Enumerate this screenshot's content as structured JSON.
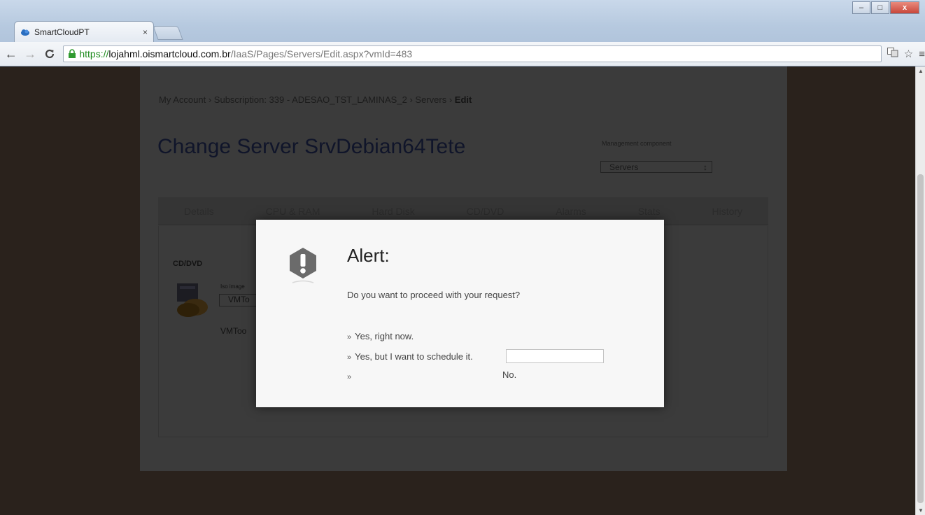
{
  "browser": {
    "tab_title": "SmartCloudPT",
    "tab_close": "×",
    "url": {
      "scheme": "https://",
      "host": "lojahml.oismartcloud.com.br",
      "path": "/IaaS/Pages/Servers/Edit.aspx?vmId=483"
    },
    "window_controls": [
      "–",
      "□",
      "x"
    ]
  },
  "page": {
    "breadcrumb": {
      "items": [
        "My Account",
        "Subscription: 339 - ADESAO_TST_LAMINAS_2",
        "Servers"
      ],
      "current": "Edit",
      "separator": "›"
    },
    "title": "Change Server SrvDebian64Tete",
    "management_label": "Management component",
    "management_value": "Servers",
    "tabs": [
      "Details",
      "CPU & RAM",
      "Hard Disk",
      "CD/DVD",
      "Alarms",
      "Stats",
      "History"
    ],
    "cd_label": "CD/DVD",
    "iso_label": "Iso image",
    "iso_value": "VMTo",
    "vmtools_text": "VMToo"
  },
  "modal": {
    "title": "Alert:",
    "message": "Do you want to proceed with your request?",
    "option_yes_now": "Yes, right now.",
    "option_schedule": "Yes, but I want to schedule it.",
    "option_no": "No.",
    "bullet": "»",
    "schedule_input_value": ""
  },
  "colors": {
    "overlay": "#2a221c",
    "modal_bg": "#f7f7f7",
    "icon_gray": "#6b6b6b",
    "url_green": "#1d8a1d"
  }
}
